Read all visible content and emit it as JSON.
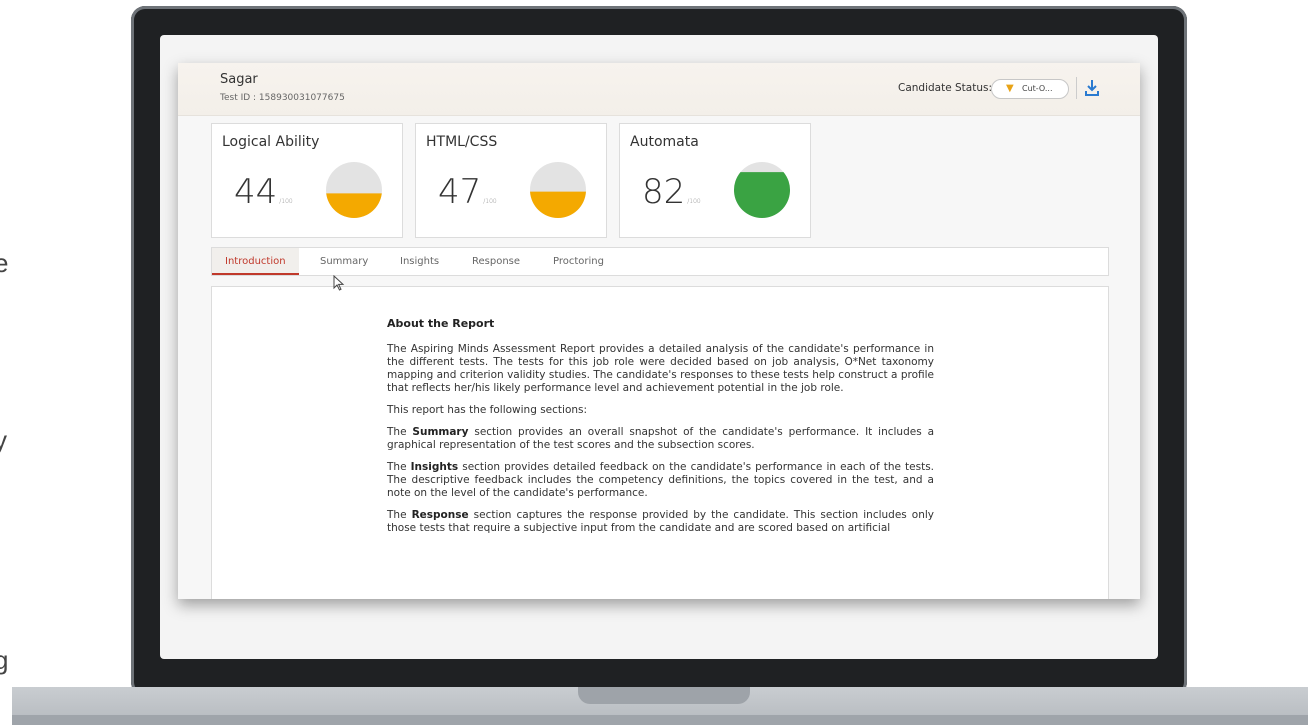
{
  "header": {
    "candidate_name": "Sagar",
    "test_id": "Test ID : 158930031077675",
    "status_label": "Candidate Status:",
    "status_value": "Cut-O..."
  },
  "cards": [
    {
      "title": "Logical Ability",
      "score": "44",
      "denominator": "/100",
      "fill": 0.44,
      "color": "#f4a900"
    },
    {
      "title": "HTML/CSS",
      "score": "47",
      "denominator": "/100",
      "fill": 0.47,
      "color": "#f4a900"
    },
    {
      "title": "Automata",
      "score": "82",
      "denominator": "/100",
      "fill": 0.82,
      "color": "#3aa343"
    }
  ],
  "tabs": [
    "Introduction",
    "Summary",
    "Insights",
    "Response",
    "Proctoring"
  ],
  "active_tab": "Introduction",
  "report": {
    "heading": "About the Report",
    "intro": "The Aspiring Minds Assessment Report provides a detailed analysis of the candidate's performance in the different tests. The tests for this job role were decided based on job analysis, O*Net taxonomy mapping and criterion validity studies. The candidate's responses to these tests help construct a profile that reflects her/his likely performance level and achievement potential in the job role.",
    "sections_line": "This report has the following sections:",
    "summary_label": "Summary",
    "summary_text": "section provides an overall snapshot of the candidate's performance. It includes a graphical representation of the test scores and the subsection scores.",
    "insights_label": "Insights",
    "insights_text": "section provides detailed feedback on the candidate's performance in each of the tests. The descriptive feedback includes the competency definitions, the topics covered in the test, and a note on the level of the candidate's performance.",
    "response_label": "Response",
    "response_text": "section captures the response provided by the candidate. This section includes only those tests that require a subjective input from the candidate and are scored based on artificial",
    "the_word": "The"
  },
  "edge_glyphs": [
    "e",
    "y",
    "g"
  ]
}
